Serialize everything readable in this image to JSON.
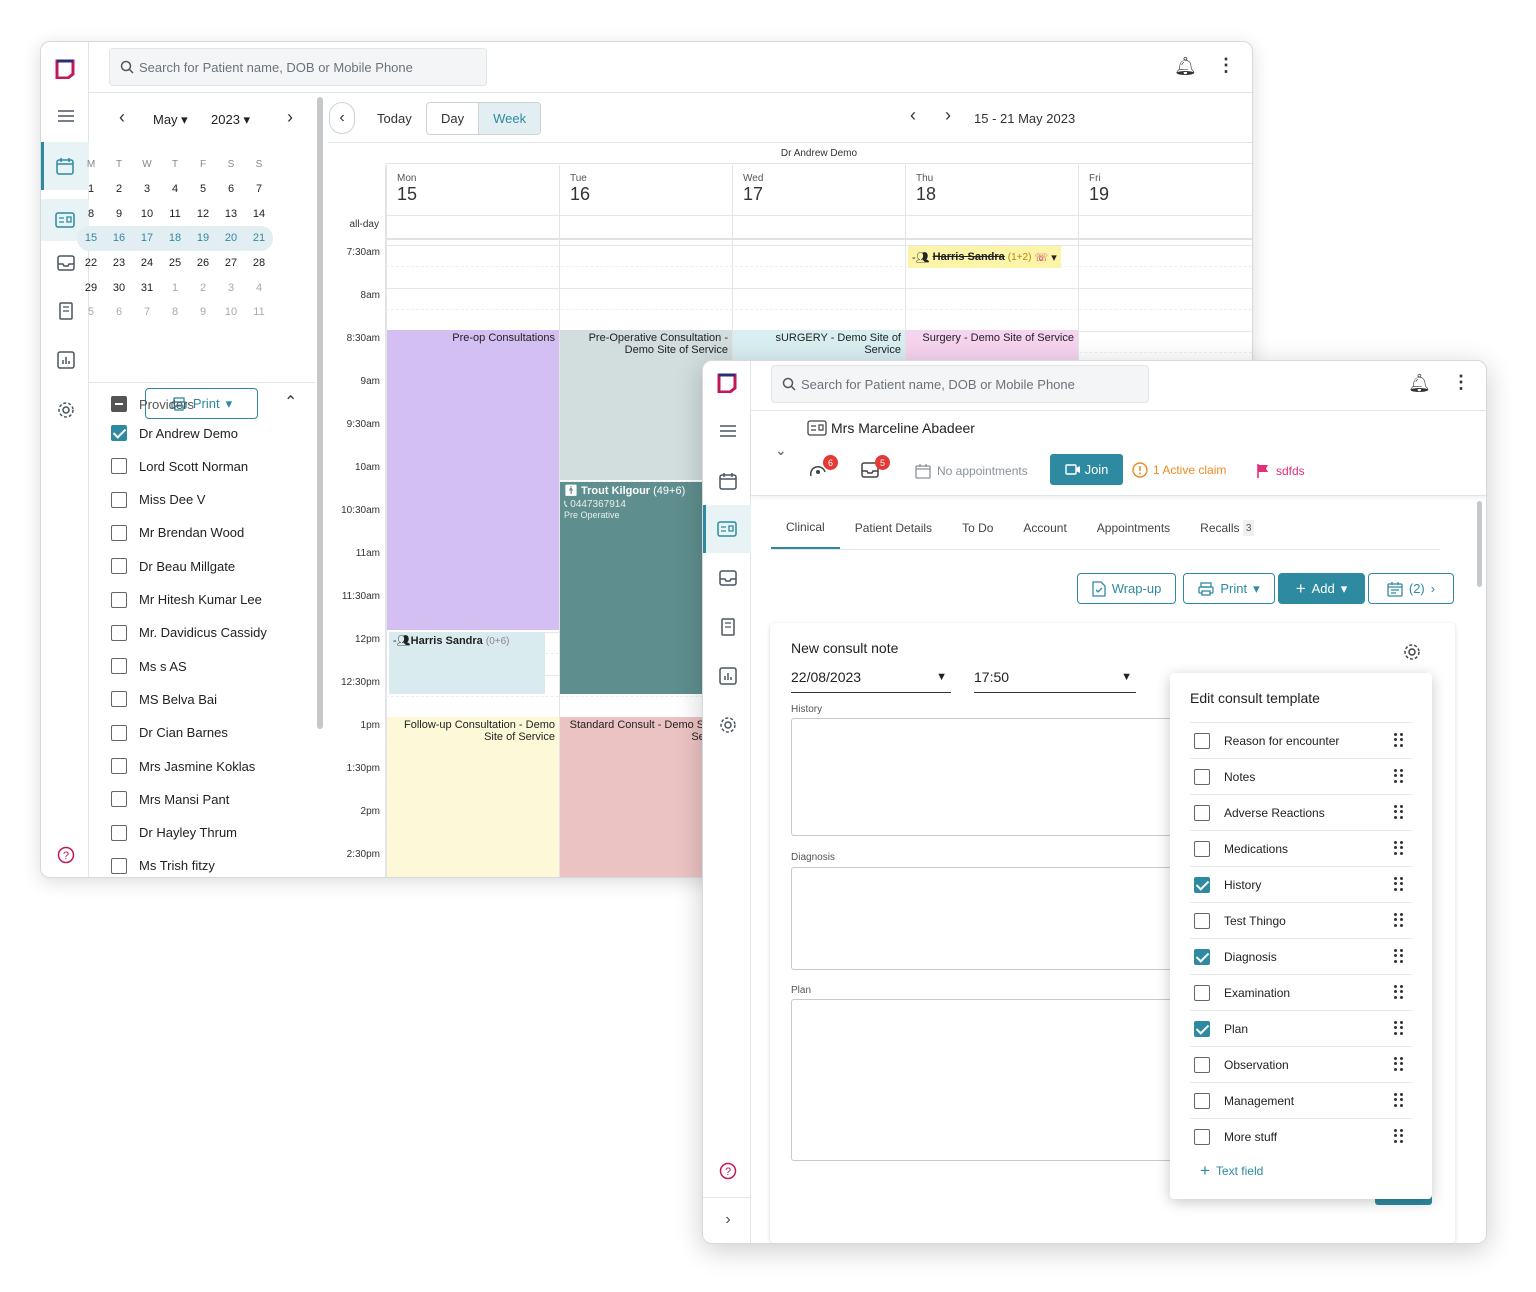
{
  "calendar_window": {
    "search_placeholder": "Search for Patient name, DOB or Mobile Phone",
    "minical": {
      "month": "May",
      "year": "2023",
      "weekdays": [
        "M",
        "T",
        "W",
        "T",
        "F",
        "S",
        "S"
      ],
      "weeks": [
        [
          "1",
          "2",
          "3",
          "4",
          "5",
          "6",
          "7"
        ],
        [
          "8",
          "9",
          "10",
          "11",
          "12",
          "13",
          "14"
        ],
        [
          "15",
          "16",
          "17",
          "18",
          "19",
          "20",
          "21"
        ],
        [
          "22",
          "23",
          "24",
          "25",
          "26",
          "27",
          "28"
        ],
        [
          "29",
          "30",
          "31",
          "1",
          "2",
          "3",
          "4"
        ],
        [
          "5",
          "6",
          "7",
          "8",
          "9",
          "10",
          "11"
        ]
      ],
      "print_label": "Print"
    },
    "providers_label": "Providers",
    "providers": [
      {
        "name": "Dr Andrew Demo",
        "checked": true
      },
      {
        "name": "Lord Scott Norman",
        "checked": false
      },
      {
        "name": "Miss Dee V",
        "checked": false
      },
      {
        "name": "Mr Brendan Wood",
        "checked": false
      },
      {
        "name": "Dr Beau Millgate",
        "checked": false
      },
      {
        "name": "Mr Hitesh Kumar Lee",
        "checked": false
      },
      {
        "name": "Mr. Davidicus Cassidy",
        "checked": false
      },
      {
        "name": "Ms s AS",
        "checked": false
      },
      {
        "name": "MS Belva Bai",
        "checked": false
      },
      {
        "name": "Dr Cian Barnes",
        "checked": false
      },
      {
        "name": "Mrs Jasmine Koklas",
        "checked": false
      },
      {
        "name": "Mrs Mansi Pant",
        "checked": false
      },
      {
        "name": "Dr Hayley Thrum",
        "checked": false
      },
      {
        "name": "Ms Trish fitzy",
        "checked": false
      }
    ],
    "toolbar": {
      "today": "Today",
      "day": "Day",
      "week": "Week",
      "range": "15 - 21 May 2023"
    },
    "provider_header": "Dr Andrew Demo",
    "days": [
      {
        "name": "Mon",
        "num": "15"
      },
      {
        "name": "Tue",
        "num": "16"
      },
      {
        "name": "Wed",
        "num": "17"
      },
      {
        "name": "Thu",
        "num": "18"
      },
      {
        "name": "Fri",
        "num": "19"
      }
    ],
    "allday": "all-day",
    "times": [
      "7:30am",
      "8am",
      "8:30am",
      "9am",
      "9:30am",
      "10am",
      "10:30am",
      "11am",
      "11:30am",
      "12pm",
      "12:30pm",
      "1pm",
      "1:30pm",
      "2pm",
      "2:30pm"
    ],
    "events": {
      "harris_thu": {
        "name": "Harris Sandra",
        "extra": "(1+2)"
      },
      "preop_mon": "Pre-op Consultations",
      "preop_tue": "Pre-Operative Consultation - Demo Site of Service",
      "surgery_wed": "sURGERY - Demo Site of Service",
      "surgery_thu": "Surgery - Demo Site of Service",
      "trout": {
        "name": "Trout Kilgour",
        "extra": "(49+6)",
        "phone": "0447367914",
        "type": "Pre Operative"
      },
      "harris_mon": {
        "name": "Harris Sandra",
        "extra": "(0+6)"
      },
      "followup_mon": "Follow-up Consultation - Demo Site of Service",
      "standard_tue": "Standard Consult - Demo Site of Service"
    }
  },
  "patient_window": {
    "search_placeholder": "Search for Patient name, DOB or Mobile Phone",
    "patient_name": "Mrs Marceline Abadeer",
    "badge_a": "6",
    "badge_b": "5",
    "no_appointments": "No appointments",
    "join": "Join",
    "active_claim": "1 Active claim",
    "flag": "sdfds",
    "tabs": [
      "Clinical",
      "Patient Details",
      "To Do",
      "Account",
      "Appointments",
      "Recalls"
    ],
    "recalls_count": "3",
    "actions": {
      "wrapup": "Wrap-up",
      "print": "Print",
      "add": "Add",
      "calendar": "(2)"
    },
    "note": {
      "title": "New consult note",
      "date": "22/08/2023",
      "time": "17:50",
      "history": "History",
      "diagnosis": "Diagnosis",
      "plan": "Plan"
    },
    "template": {
      "title": "Edit consult template",
      "items": [
        {
          "label": "Reason for encounter",
          "checked": false
        },
        {
          "label": "Notes",
          "checked": false
        },
        {
          "label": "Adverse Reactions",
          "checked": false
        },
        {
          "label": "Medications",
          "checked": false
        },
        {
          "label": "History",
          "checked": true
        },
        {
          "label": "Test Thingo",
          "checked": false
        },
        {
          "label": "Diagnosis",
          "checked": true
        },
        {
          "label": "Examination",
          "checked": false
        },
        {
          "label": "Plan",
          "checked": true
        },
        {
          "label": "Observation",
          "checked": false
        },
        {
          "label": "Management",
          "checked": false
        },
        {
          "label": "More stuff",
          "checked": false
        }
      ],
      "add_text_field": "Text field"
    }
  },
  "colors": {
    "accent": "#2e8aa0",
    "brand": "#c2185b",
    "purple": "#d4bff2",
    "teal_block": "#5f8e8e",
    "yellow": "#fdf8d8",
    "pink": "#ecc3c3",
    "grey_teal": "#d1dedd",
    "light_blue": "#d9eef1"
  }
}
